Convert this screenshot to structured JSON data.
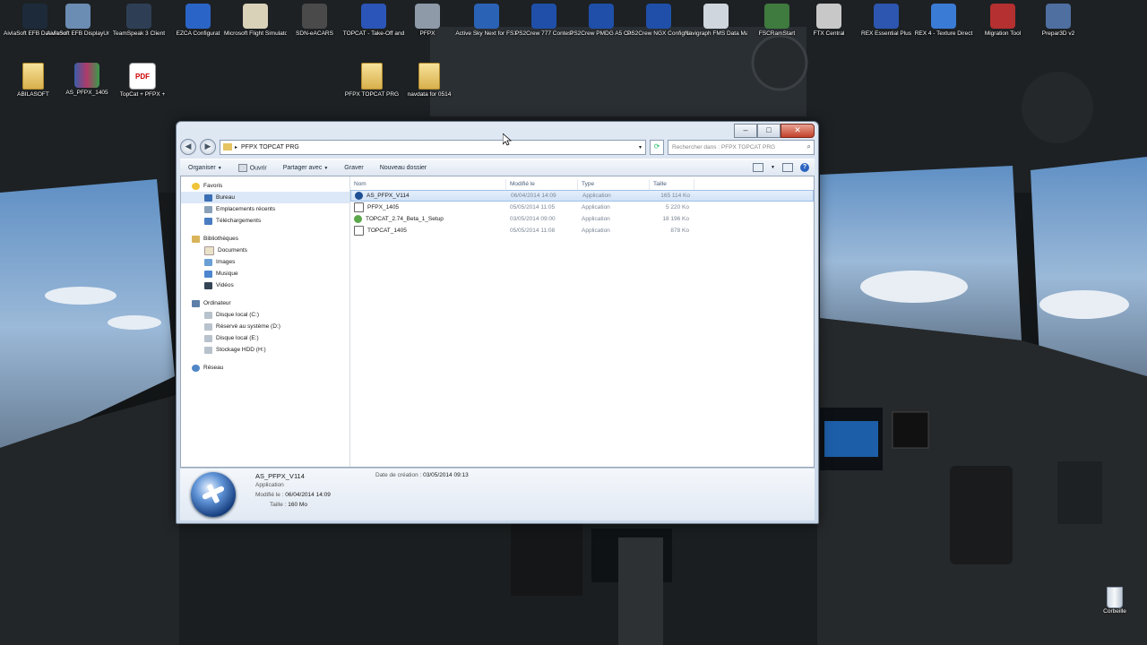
{
  "desktop": {
    "icons_top": [
      {
        "label": "AivlaSoft EFB DataProvider",
        "icon": "efb-monitor-icon",
        "color": "#1c2a3a"
      },
      {
        "label": "AivlaSoft EFB DisplayUnit",
        "icon": "globe-icon",
        "color": "#6b8cb3"
      },
      {
        "label": "TeamSpeak 3 Client",
        "icon": "teamspeak-icon",
        "color": "#2e3f55"
      },
      {
        "label": "EZCA Configurat",
        "icon": "wrench-icon",
        "color": "#2b64c7"
      },
      {
        "label": "Microsoft Flight Simulator X",
        "icon": "fsx-icon",
        "color": "#d9d2b8"
      },
      {
        "label": "SDN-eACARS",
        "icon": "plane-icon",
        "color": "#4a4a4a"
      },
      {
        "label": "TOPCAT - Take-Off and",
        "icon": "topcat-icon",
        "color": "#2b55b8"
      },
      {
        "label": "PFPX",
        "icon": "pfpx-globe-icon",
        "color": "#8e9aa8"
      },
      {
        "label": "Active Sky Next for FSX",
        "icon": "asn-icon",
        "color": "#2a62b6"
      },
      {
        "label": "PS2Crew 777 Contest",
        "icon": "ps2crew-icon",
        "color": "#1f4fa8"
      },
      {
        "label": "PS2Crew PMDG A5 Config M...",
        "icon": "ps2crew-icon",
        "color": "#1f4fa8"
      },
      {
        "label": "PS2Crew NGX Config Manager",
        "icon": "ps2crew-icon",
        "color": "#1f4fa8"
      },
      {
        "label": "Navigraph FMS Data Manager",
        "icon": "navigraph-icon",
        "color": "#cfd6de"
      },
      {
        "label": "FSCRamStart",
        "icon": "globe-icon",
        "color": "#3f7a3f"
      },
      {
        "label": "FTX Central",
        "icon": "ftx-icon",
        "color": "#c8c8c8"
      },
      {
        "label": "REX Essential Plus",
        "icon": "rex-icon",
        "color": "#2c56b0"
      },
      {
        "label": "REX 4 - Texture Direct",
        "icon": "cloud-icon",
        "color": "#3a7bd5"
      },
      {
        "label": "Migration Tool",
        "icon": "migration-icon",
        "color": "#b53030"
      },
      {
        "label": "Prepar3D v2",
        "icon": "prepar3d-icon",
        "color": "#4f6fa0"
      }
    ],
    "icons_row2": [
      {
        "label": "ABILASOFT",
        "icon": "folder-icon"
      },
      {
        "label": "AS_PFPX_1405",
        "icon": "rar-archive-icon"
      },
      {
        "label": "TopCat + PFPX +",
        "icon": "pdf-icon"
      },
      {
        "label": "PFPX TOPCAT PRG",
        "icon": "folder-icon"
      },
      {
        "label": "navdata for 0514",
        "icon": "folder-icon"
      }
    ],
    "recycle_bin_label": "Corbeille"
  },
  "window": {
    "breadcrumb": "PFPX TOPCAT PRG",
    "search_placeholder": "Rechercher dans : PFPX TOPCAT PRG",
    "toolbar": {
      "organize": "Organiser",
      "open": "Ouvrir",
      "share": "Partager avec",
      "burn": "Graver",
      "new_folder": "Nouveau dossier"
    },
    "nav": {
      "favorites": {
        "title": "Favoris",
        "items": [
          "Bureau",
          "Emplacements récents",
          "Téléchargements"
        ]
      },
      "libraries": {
        "title": "Bibliothèques",
        "items": [
          "Documents",
          "Images",
          "Musique",
          "Vidéos"
        ]
      },
      "computer": {
        "title": "Ordinateur",
        "items": [
          "Disque local (C:)",
          "Réservé au système (D:)",
          "Disque local (E:)",
          "Stockage HDD (H:)"
        ]
      },
      "network": {
        "title": "Réseau"
      }
    },
    "columns": {
      "name": "Nom",
      "modified": "Modifié le",
      "type": "Type",
      "size": "Taille"
    },
    "files": [
      {
        "name": "AS_PFPX_V114",
        "modified": "06/04/2014 14:09",
        "type": "Application",
        "size": "165 114 Ko",
        "icon": "pfpx-app-icon",
        "selected": true
      },
      {
        "name": "PFPX_1405",
        "modified": "05/05/2014 11:05",
        "type": "Application",
        "size": "5 220 Ko",
        "icon": "installer-icon",
        "selected": false
      },
      {
        "name": "TOPCAT_2.74_Beta_1_Setup",
        "modified": "03/05/2014 09:00",
        "type": "Application",
        "size": "18 196 Ko",
        "icon": "setup-icon",
        "selected": false
      },
      {
        "name": "TOPCAT_1405",
        "modified": "05/05/2014 11:08",
        "type": "Application",
        "size": "878 Ko",
        "icon": "installer-icon",
        "selected": false
      }
    ],
    "details": {
      "name": "AS_PFPX_V114",
      "type": "Application",
      "modified_label": "Modifié le :",
      "modified_value": "06/04/2014 14:09",
      "size_label": "Taille :",
      "size_value": "160 Mo",
      "created_label": "Date de création :",
      "created_value": "03/05/2014 09:13"
    }
  }
}
